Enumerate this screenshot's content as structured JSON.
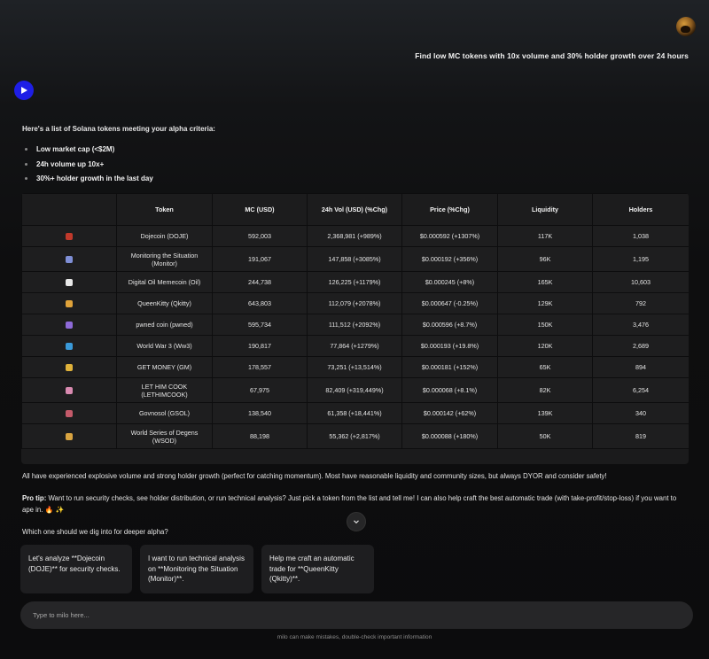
{
  "user": {
    "message": "Find low MC tokens with 10x volume and 30% holder growth over 24 hours"
  },
  "assistant": {
    "intro": "Here's a list of Solana tokens meeting your alpha criteria:",
    "criteria": [
      "Low market cap (<$2M)",
      "24h volume up 10x+",
      "30%+ holder growth in the last day"
    ],
    "summary": "All have experienced explosive volume and strong holder growth (perfect for catching momentum). Most have reasonable liquidity and community sizes, but always DYOR and consider safety!",
    "pro_tip_label": "Pro tip:",
    "pro_tip_text": " Want to run security checks, see holder distribution, or run technical analysis? Just pick a token from the list and tell me! I can also help craft the best automatic trade (with take-profit/stop-loss) if you want to ape in. 🔥 ✨",
    "question": "Which one should we dig into for deeper alpha?"
  },
  "table": {
    "headers": [
      "",
      "Token",
      "MC (USD)",
      "24h Vol (USD) (%Chg)",
      "Price (%Chg)",
      "Liquidity",
      "Holders"
    ],
    "rows": [
      {
        "icon": "dog-icon",
        "color": "#c0392b",
        "token": "Dojecoin (DOJE)",
        "mc": "592,003",
        "vol": "2,368,981 (+989%)",
        "price": "$0.000592 (+1307%)",
        "liq": "117K",
        "holders": "1,038"
      },
      {
        "icon": "monitor-icon",
        "color": "#7f8fd6",
        "token": "Monitoring the Situation (Monitor)",
        "mc": "191,067",
        "vol": "147,858 (+3085%)",
        "price": "$0.000192 (+356%)",
        "liq": "96K",
        "holders": "1,195"
      },
      {
        "icon": "oil-icon",
        "color": "#e8e8e8",
        "token": "Digital Oil Memecoin (Oil)",
        "mc": "244,738",
        "vol": "126,225 (+1179%)",
        "price": "$0.000245 (+8%)",
        "liq": "165K",
        "holders": "10,603"
      },
      {
        "icon": "crown-icon",
        "color": "#e0a33a",
        "token": "QueenKitty (Qkitty)",
        "mc": "643,803",
        "vol": "112,079 (+2078%)",
        "price": "$0.000647 (-0.25%)",
        "liq": "129K",
        "holders": "792"
      },
      {
        "icon": "pixel-icon",
        "color": "#8e6ad8",
        "token": "pwned coin (pwned)",
        "mc": "595,734",
        "vol": "111,512 (+2092%)",
        "price": "$0.000596 (+8.7%)",
        "liq": "150K",
        "holders": "3,476"
      },
      {
        "icon": "globe-icon",
        "color": "#3a9ad9",
        "token": "World War 3 (Ww3)",
        "mc": "190,817",
        "vol": "77,864 (+1279%)",
        "price": "$0.000193 (+19.8%)",
        "liq": "120K",
        "holders": "2,689"
      },
      {
        "icon": "money-bag-icon",
        "color": "#e0b23a",
        "token": "GET MONEY (GM)",
        "mc": "178,557",
        "vol": "73,251 (+13,514%)",
        "price": "$0.000181 (+152%)",
        "liq": "65K",
        "holders": "894"
      },
      {
        "icon": "chef-icon",
        "color": "#d98ab0",
        "token": "LET HIM COOK (LETHIMCOOK)",
        "mc": "67,975",
        "vol": "82,409 (+319,449%)",
        "price": "$0.000068 (+8.1%)",
        "liq": "82K",
        "holders": "6,254"
      },
      {
        "icon": "warship-icon",
        "color": "#c45a6a",
        "token": "Govnosol (GSOL)",
        "mc": "138,540",
        "vol": "61,358 (+18,441%)",
        "price": "$0.000142 (+62%)",
        "liq": "139K",
        "holders": "340"
      },
      {
        "icon": "trophy-icon",
        "color": "#d9a441",
        "token": "World Series of Degens (WSOD)",
        "mc": "88,198",
        "vol": "55,362 (+2,817%)",
        "price": "$0.000088 (+180%)",
        "liq": "50K",
        "holders": "819"
      }
    ]
  },
  "suggestions": [
    "Let's analyze **Dojecoin (DOJE)** for security checks.",
    "I want to run technical analysis on **Monitoring the Situation (Monitor)**.",
    "Help me craft an automatic trade for **QueenKitty (Qkitty)**."
  ],
  "input": {
    "placeholder": "Type to milo here..."
  },
  "footer": {
    "disclaimer": "milo can make mistakes, double-check important information"
  }
}
